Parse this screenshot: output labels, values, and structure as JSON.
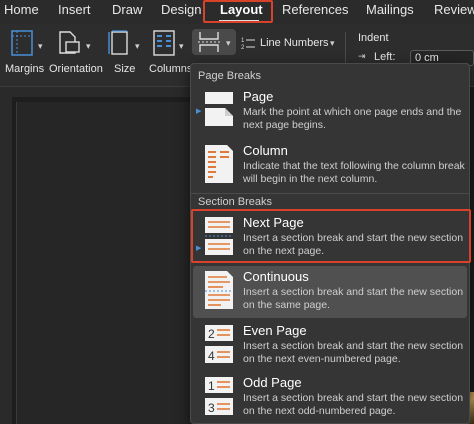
{
  "ribbon_tabs": [
    "Home",
    "Insert",
    "Draw",
    "Design",
    "Layout",
    "References",
    "Mailings",
    "Review"
  ],
  "active_tab": "Layout",
  "ribbon": {
    "margins": "Margins",
    "orientation": "Orientation",
    "size": "Size",
    "columns": "Columns",
    "line_numbers": "Line Numbers",
    "indent": "Indent",
    "left_label": "Left:",
    "left_value": "0 cm"
  },
  "menu": {
    "page_breaks_header": "Page Breaks",
    "section_breaks_header": "Section Breaks",
    "items": [
      {
        "title": "Page",
        "desc": "Mark the point at which one page ends and the next page begins."
      },
      {
        "title": "Column",
        "desc": "Indicate that the text following the column break will begin in the next column."
      },
      {
        "title": "Next Page",
        "desc": "Insert a section break and start the new section on the next page."
      },
      {
        "title": "Continuous",
        "desc": "Insert a section break and start the new section on the same page."
      },
      {
        "title": "Even Page",
        "desc": "Insert a section break and start the new section on the next even-numbered page."
      },
      {
        "title": "Odd Page",
        "desc": "Insert a section break and start the new section on the next odd-numbered page."
      }
    ]
  },
  "icons": {
    "even_numbers": [
      "2",
      "4"
    ],
    "odd_numbers": [
      "1",
      "3"
    ]
  },
  "colors": {
    "highlight": "#d8422a",
    "accent": "#4a90d9"
  }
}
